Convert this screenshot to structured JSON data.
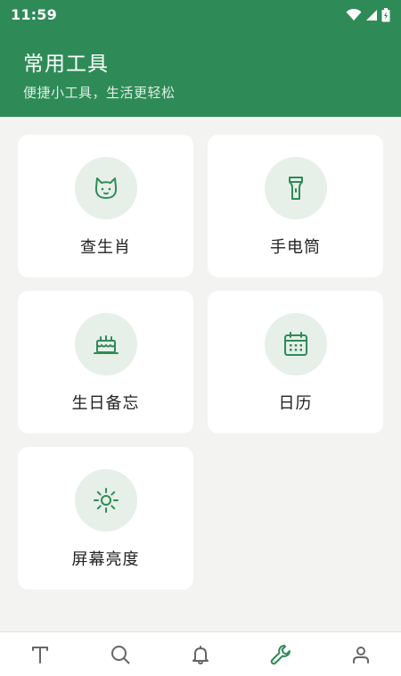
{
  "status_bar": {
    "time": "11:59"
  },
  "header": {
    "title": "常用工具",
    "subtitle": "便捷小工具，生活更轻松"
  },
  "tools": [
    {
      "label": "查生肖",
      "icon": "cat-face-icon"
    },
    {
      "label": "手电筒",
      "icon": "flashlight-icon"
    },
    {
      "label": "生日备忘",
      "icon": "birthday-cake-icon"
    },
    {
      "label": "日历",
      "icon": "calendar-icon"
    },
    {
      "label": "屏幕亮度",
      "icon": "sun-brightness-icon"
    }
  ],
  "bottom_nav": [
    {
      "icon": "text-icon",
      "active": false
    },
    {
      "icon": "search-icon",
      "active": false
    },
    {
      "icon": "bell-icon",
      "active": false
    },
    {
      "icon": "wrench-icon",
      "active": true
    },
    {
      "icon": "user-icon",
      "active": false
    }
  ],
  "colors": {
    "primary": "#2e8b57",
    "icon_circle": "#e7efe9",
    "background": "#f3f4f2",
    "nav_inactive": "#666666"
  }
}
